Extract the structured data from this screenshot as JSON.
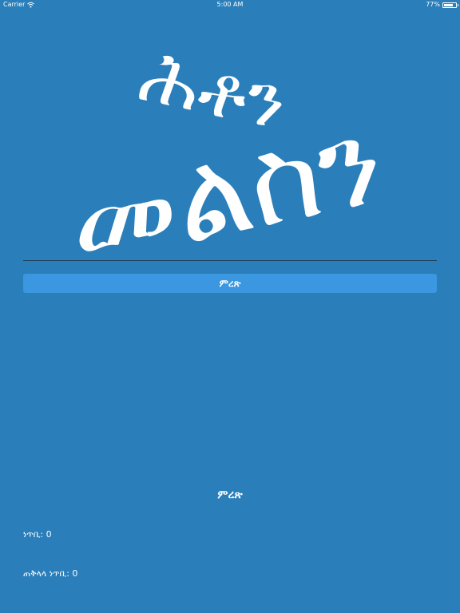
{
  "status_bar": {
    "carrier": "Carrier",
    "time": "5:00 AM",
    "battery_percent": "77%",
    "battery_level": 0.77
  },
  "word_image": {
    "line1": "ሕቶን",
    "line2": "መልስን"
  },
  "choose_button": {
    "label": "ምረጽ"
  },
  "result": {
    "label": "ምረጽ"
  },
  "score": {
    "text": "ነጥቢ: 0"
  },
  "total_score": {
    "text": "ጠቅላላ ነጥቢ: 0"
  }
}
